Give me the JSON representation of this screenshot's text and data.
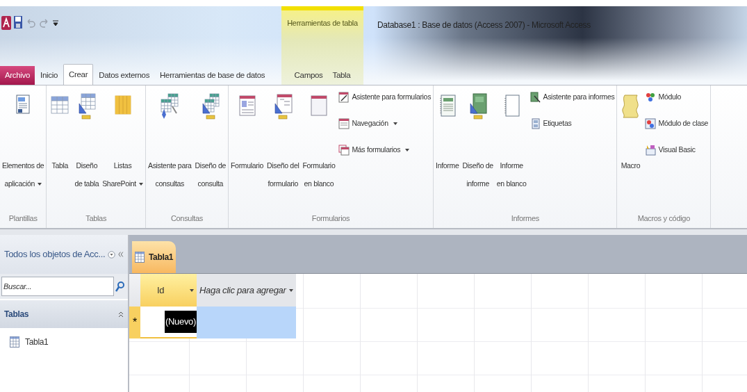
{
  "window": {
    "title": "Database1 : Base de datos (Access 2007)  -  Microsoft Access"
  },
  "contextual_group": {
    "label": "Herramientas de tabla"
  },
  "tabs": [
    {
      "label": "Archivo",
      "kind": "file",
      "selected": false
    },
    {
      "label": "Inicio",
      "kind": "normal",
      "selected": false
    },
    {
      "label": "Crear",
      "kind": "normal",
      "selected": true
    },
    {
      "label": "Datos externos",
      "kind": "normal",
      "selected": false
    },
    {
      "label": "Herramientas de base de datos",
      "kind": "normal",
      "selected": false
    },
    {
      "label": "Campos",
      "kind": "contextual",
      "selected": false
    },
    {
      "label": "Tabla",
      "kind": "contextual",
      "selected": false
    }
  ],
  "ribbon_groups": [
    {
      "label": "Plantillas",
      "commands": [
        {
          "kind": "large",
          "lines": [
            "Elementos de",
            "aplicación"
          ],
          "dropdown": true
        }
      ]
    },
    {
      "label": "Tablas",
      "commands": [
        {
          "kind": "large",
          "lines": [
            "Tabla"
          ],
          "dropdown": false
        },
        {
          "kind": "large",
          "lines": [
            "Diseño",
            "de tabla"
          ],
          "dropdown": false
        },
        {
          "kind": "large",
          "lines": [
            "Listas",
            "SharePoint"
          ],
          "dropdown": true
        }
      ]
    },
    {
      "label": "Consultas",
      "commands": [
        {
          "kind": "large",
          "lines": [
            "Asistente para",
            "consultas"
          ],
          "dropdown": false
        },
        {
          "kind": "large",
          "lines": [
            "Diseño de",
            "consulta"
          ],
          "dropdown": false
        }
      ]
    },
    {
      "label": "Formularios",
      "commands": [
        {
          "kind": "large",
          "lines": [
            "Formulario"
          ],
          "dropdown": false
        },
        {
          "kind": "large",
          "lines": [
            "Diseño del",
            "formulario"
          ],
          "dropdown": false
        },
        {
          "kind": "large",
          "lines": [
            "Formulario",
            "en blanco"
          ],
          "dropdown": false
        },
        {
          "kind": "small",
          "lines": [
            "Asistente para formularios"
          ],
          "dropdown": false
        },
        {
          "kind": "small",
          "lines": [
            "Navegación"
          ],
          "dropdown": true
        },
        {
          "kind": "small",
          "lines": [
            "Más formularios"
          ],
          "dropdown": true
        }
      ]
    },
    {
      "label": "Informes",
      "commands": [
        {
          "kind": "large",
          "lines": [
            "Informe"
          ],
          "dropdown": false
        },
        {
          "kind": "large",
          "lines": [
            "Diseño de",
            "informe"
          ],
          "dropdown": false
        },
        {
          "kind": "large",
          "lines": [
            "Informe",
            "en blanco"
          ],
          "dropdown": false
        },
        {
          "kind": "small",
          "lines": [
            "Asistente para informes"
          ],
          "dropdown": false
        },
        {
          "kind": "small",
          "lines": [
            "Etiquetas"
          ],
          "dropdown": false
        }
      ]
    },
    {
      "label": "Macros y código",
      "commands": [
        {
          "kind": "large",
          "lines": [
            "Macro"
          ],
          "dropdown": false
        },
        {
          "kind": "small",
          "lines": [
            "Módulo"
          ],
          "dropdown": false
        },
        {
          "kind": "small",
          "lines": [
            "Módulo de clase"
          ],
          "dropdown": false
        },
        {
          "kind": "small",
          "lines": [
            "Visual Basic"
          ],
          "dropdown": false
        }
      ]
    }
  ],
  "navigation_pane": {
    "title": "Todos los objetos de Acc...",
    "search": {
      "placeholder": "Buscar..."
    },
    "groups": [
      {
        "label": "Tablas",
        "expanded": true,
        "items": [
          {
            "label": "Tabla1"
          }
        ]
      }
    ]
  },
  "document_tabs": [
    {
      "label": "Tabla1",
      "selected": true
    }
  ],
  "datasheet": {
    "columns": [
      {
        "label": "Id",
        "kind": "field",
        "selected": true
      },
      {
        "label": "Haga clic para agregar",
        "kind": "add",
        "selected": false
      }
    ],
    "new_row": {
      "marker": "*",
      "value": "(Nuevo)",
      "current": true
    }
  }
}
